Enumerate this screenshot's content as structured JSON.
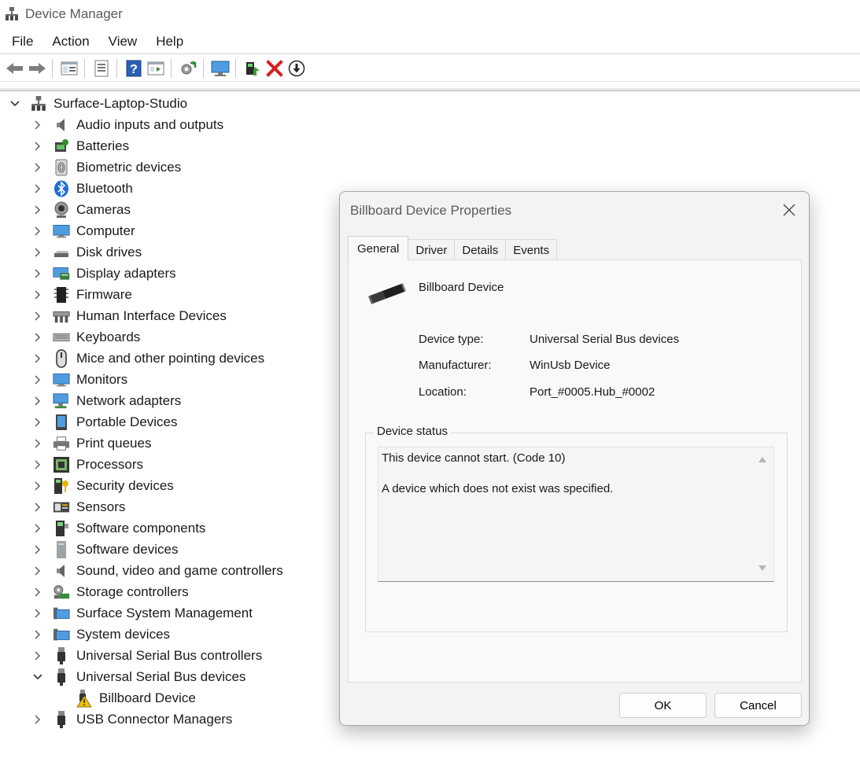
{
  "window": {
    "title": "Device Manager"
  },
  "menu": [
    "File",
    "Action",
    "View",
    "Help"
  ],
  "toolbar": {
    "icons": [
      "back-arrow-icon",
      "forward-arrow-icon",
      "show-hide-console-tree-icon",
      "properties-icon",
      "help-icon",
      "run-icon",
      "scan-hardware-icon",
      "computer-monitor-icon",
      "update-driver-icon",
      "uninstall-x-icon",
      "disable-device-icon"
    ]
  },
  "tree": {
    "root": "Surface-Laptop-Studio",
    "categories": [
      "Audio inputs and outputs",
      "Batteries",
      "Biometric devices",
      "Bluetooth",
      "Cameras",
      "Computer",
      "Disk drives",
      "Display adapters",
      "Firmware",
      "Human Interface Devices",
      "Keyboards",
      "Mice and other pointing devices",
      "Monitors",
      "Network adapters",
      "Portable Devices",
      "Print queues",
      "Processors",
      "Security devices",
      "Sensors",
      "Software components",
      "Software devices",
      "Sound, video and game controllers",
      "Storage controllers",
      "Surface System Management",
      "System devices",
      "Universal Serial Bus controllers",
      "Universal Serial Bus devices",
      "USB Connector Managers"
    ],
    "child": "Billboard Device"
  },
  "dialog": {
    "title": "Billboard Device Properties",
    "tabs": [
      "General",
      "Driver",
      "Details",
      "Events"
    ],
    "device_name": "Billboard Device",
    "device_type_label": "Device type:",
    "device_type_value": "Universal Serial Bus devices",
    "manufacturer_label": "Manufacturer:",
    "manufacturer_value": "WinUsb Device",
    "location_label": "Location:",
    "location_value": "Port_#0005.Hub_#0002",
    "status_legend": "Device status",
    "status_line1": "This device cannot start. (Code 10)",
    "status_line2": "A device which does not exist was specified.",
    "ok_label": "OK",
    "cancel_label": "Cancel"
  },
  "colors": {
    "accent_blue": "#2d7dd2",
    "error_red": "#d81e1e",
    "warning_yellow": "#f2c200"
  }
}
